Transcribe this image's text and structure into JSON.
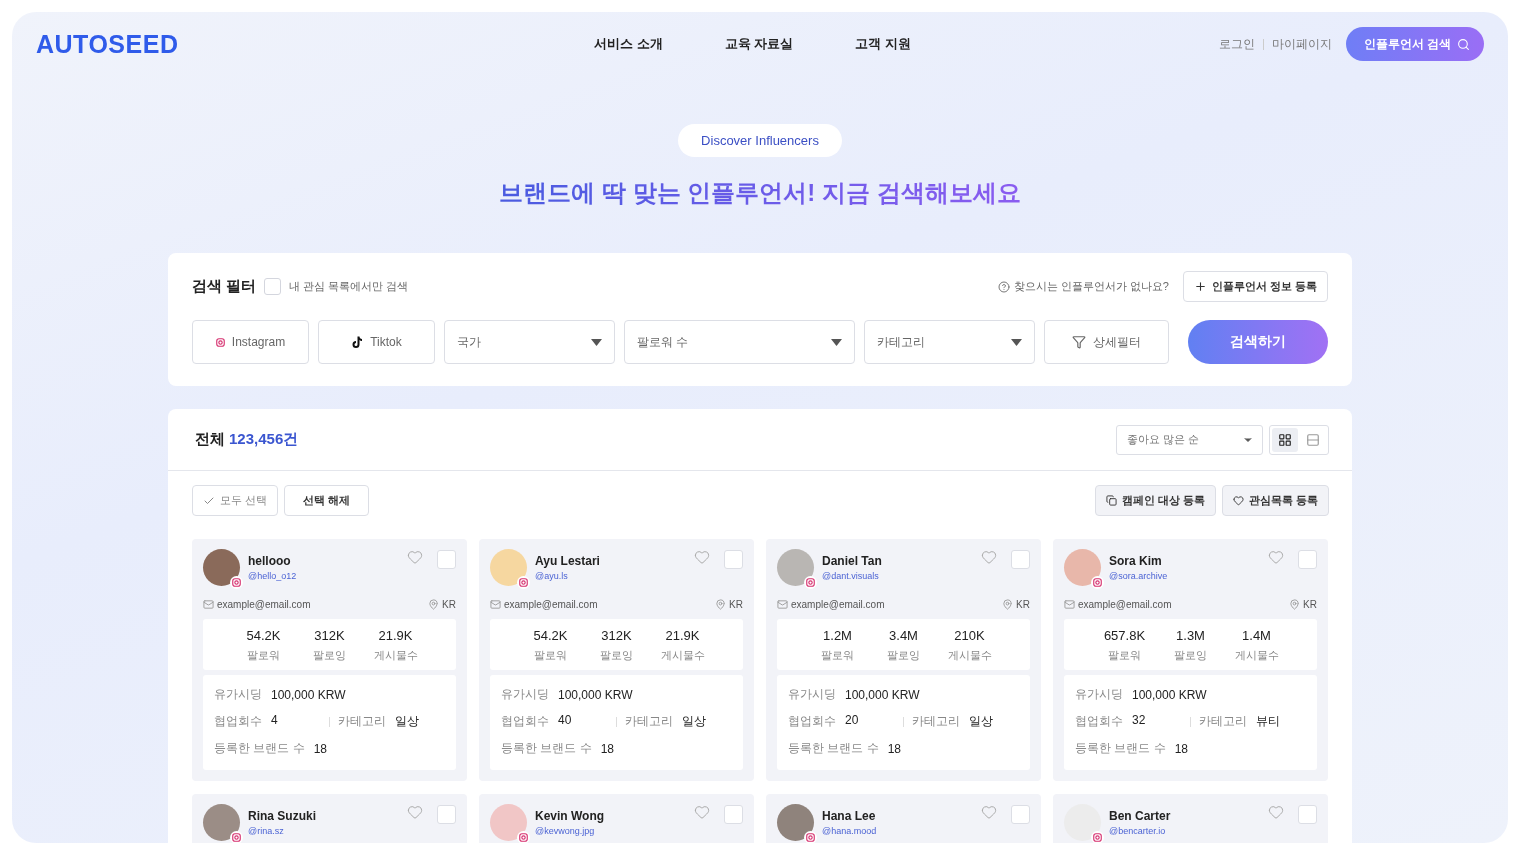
{
  "header": {
    "logo": "AUTOSEED",
    "nav": [
      "서비스 소개",
      "교육 자료실",
      "고객 지원"
    ],
    "links": [
      "로그인",
      "마이페이지"
    ],
    "cta": "인플루언서 검색"
  },
  "hero": {
    "badge": "Discover Influencers",
    "title": "브랜드에 딱 맞는 인플루언서! 지금 검색해보세요"
  },
  "filter": {
    "title": "검색 필터",
    "only_favorites": {
      "label": "내 관심 목록에서만 검색",
      "checked": false
    },
    "help": "찾으시는 인플루언서가 없나요?",
    "register": "인플루언서 정보 등록",
    "platforms": [
      {
        "kind": "instagram",
        "label": "Instagram",
        "selected": false
      },
      {
        "kind": "tiktok",
        "label": "Tiktok",
        "selected": false
      }
    ],
    "selects": [
      {
        "placeholder": "국가"
      },
      {
        "placeholder": "팔로워 수"
      },
      {
        "placeholder": "카테고리"
      }
    ],
    "detail": "상세필터",
    "search": "검색하기"
  },
  "results": {
    "label": "전체",
    "count": "123,456건",
    "sort": "좋아요 많은 순",
    "views": [
      {
        "kind": "grid",
        "selected": true
      },
      {
        "kind": "list",
        "selected": false
      }
    ],
    "select_all": "모두 선택",
    "deselect": "선택 해제",
    "campaign": "캠페인 대상 등록",
    "watchlist": "관심목록 등록",
    "cards": [
      {
        "name": "hellooo",
        "handle": "@hello_o12",
        "kind": "instagram",
        "liked": false,
        "checked": false,
        "email": "example@email.com",
        "country": "KR",
        "stats": [
          {
            "value": "54.2K",
            "label": "팔로워"
          },
          {
            "value": "312K",
            "label": "팔로잉"
          },
          {
            "value": "21.9K",
            "label": "게시물수"
          }
        ],
        "details": [
          {
            "label": "유가시딩",
            "value": "100,000 KRW"
          },
          {
            "label": "협업회수",
            "value": "4"
          },
          {
            "label": "카테고리",
            "value": "일상"
          },
          {
            "label": "등록한 브랜드 수",
            "value": "18"
          }
        ]
      },
      {
        "name": "Ayu Lestari",
        "handle": "@ayu.ls",
        "kind": "instagram",
        "liked": false,
        "checked": false,
        "email": "example@email.com",
        "country": "KR",
        "stats": [
          {
            "value": "54.2K",
            "label": "팔로워"
          },
          {
            "value": "312K",
            "label": "팔로잉"
          },
          {
            "value": "21.9K",
            "label": "게시물수"
          }
        ],
        "details": [
          {
            "label": "유가시딩",
            "value": "100,000 KRW"
          },
          {
            "label": "협업회수",
            "value": "40"
          },
          {
            "label": "카테고리",
            "value": "일상"
          },
          {
            "label": "등록한 브랜드 수",
            "value": "18"
          }
        ]
      },
      {
        "name": "Daniel Tan",
        "handle": "@dant.visuals",
        "kind": "instagram",
        "liked": false,
        "checked": false,
        "email": "example@email.com",
        "country": "KR",
        "stats": [
          {
            "value": "1.2M",
            "label": "팔로워"
          },
          {
            "value": "3.4M",
            "label": "팔로잉"
          },
          {
            "value": "210K",
            "label": "게시물수"
          }
        ],
        "details": [
          {
            "label": "유가시딩",
            "value": "100,000 KRW"
          },
          {
            "label": "협업회수",
            "value": "20"
          },
          {
            "label": "카테고리",
            "value": "일상"
          },
          {
            "label": "등록한 브랜드 수",
            "value": "18"
          }
        ]
      },
      {
        "name": "Sora Kim",
        "handle": "@sora.archive",
        "kind": "instagram",
        "liked": false,
        "checked": false,
        "email": "example@email.com",
        "country": "KR",
        "stats": [
          {
            "value": "657.8K",
            "label": "팔로워"
          },
          {
            "value": "1.3M",
            "label": "팔로잉"
          },
          {
            "value": "1.4M",
            "label": "게시물수"
          }
        ],
        "details": [
          {
            "label": "유가시딩",
            "value": "100,000 KRW"
          },
          {
            "label": "협업회수",
            "value": "32"
          },
          {
            "label": "카테고리",
            "value": "뷰티"
          },
          {
            "label": "등록한 브랜드 수",
            "value": "18"
          }
        ]
      },
      {
        "name": "Rina Suzuki",
        "handle": "@rina.sz",
        "kind": "instagram",
        "liked": false,
        "checked": false
      },
      {
        "name": "Kevin Wong",
        "handle": "@kevwong.jpg",
        "kind": "instagram",
        "liked": false,
        "checked": false
      },
      {
        "name": "Hana Lee",
        "handle": "@hana.mood",
        "kind": "instagram",
        "liked": false,
        "checked": false
      },
      {
        "name": "Ben Carter",
        "handle": "@bencarter.io",
        "kind": "instagram",
        "liked": false,
        "checked": false
      }
    ]
  }
}
